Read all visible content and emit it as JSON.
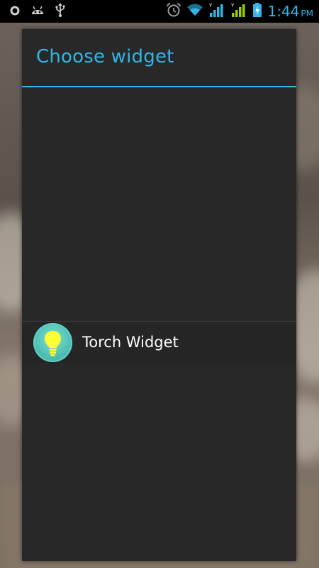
{
  "status_bar": {
    "time": "1:44",
    "ampm": "PM",
    "left_icons": [
      "notification-ring-icon",
      "android-debug-icon",
      "usb-icon"
    ],
    "right_icons": [
      "alarm-icon",
      "wifi-icon",
      "signal-1-icon",
      "signal-2-icon",
      "battery-charging-icon"
    ],
    "accent_color": "#33b5e5"
  },
  "dialog": {
    "title": "Choose widget",
    "items": [
      {
        "label": "Torch Widget",
        "icon": "lightbulb-icon"
      }
    ]
  },
  "colors": {
    "accent": "#33b5e5",
    "dialog_bg": "#282828",
    "icon_teal": "#49b8ad",
    "bulb_yellow": "#ffff33"
  }
}
